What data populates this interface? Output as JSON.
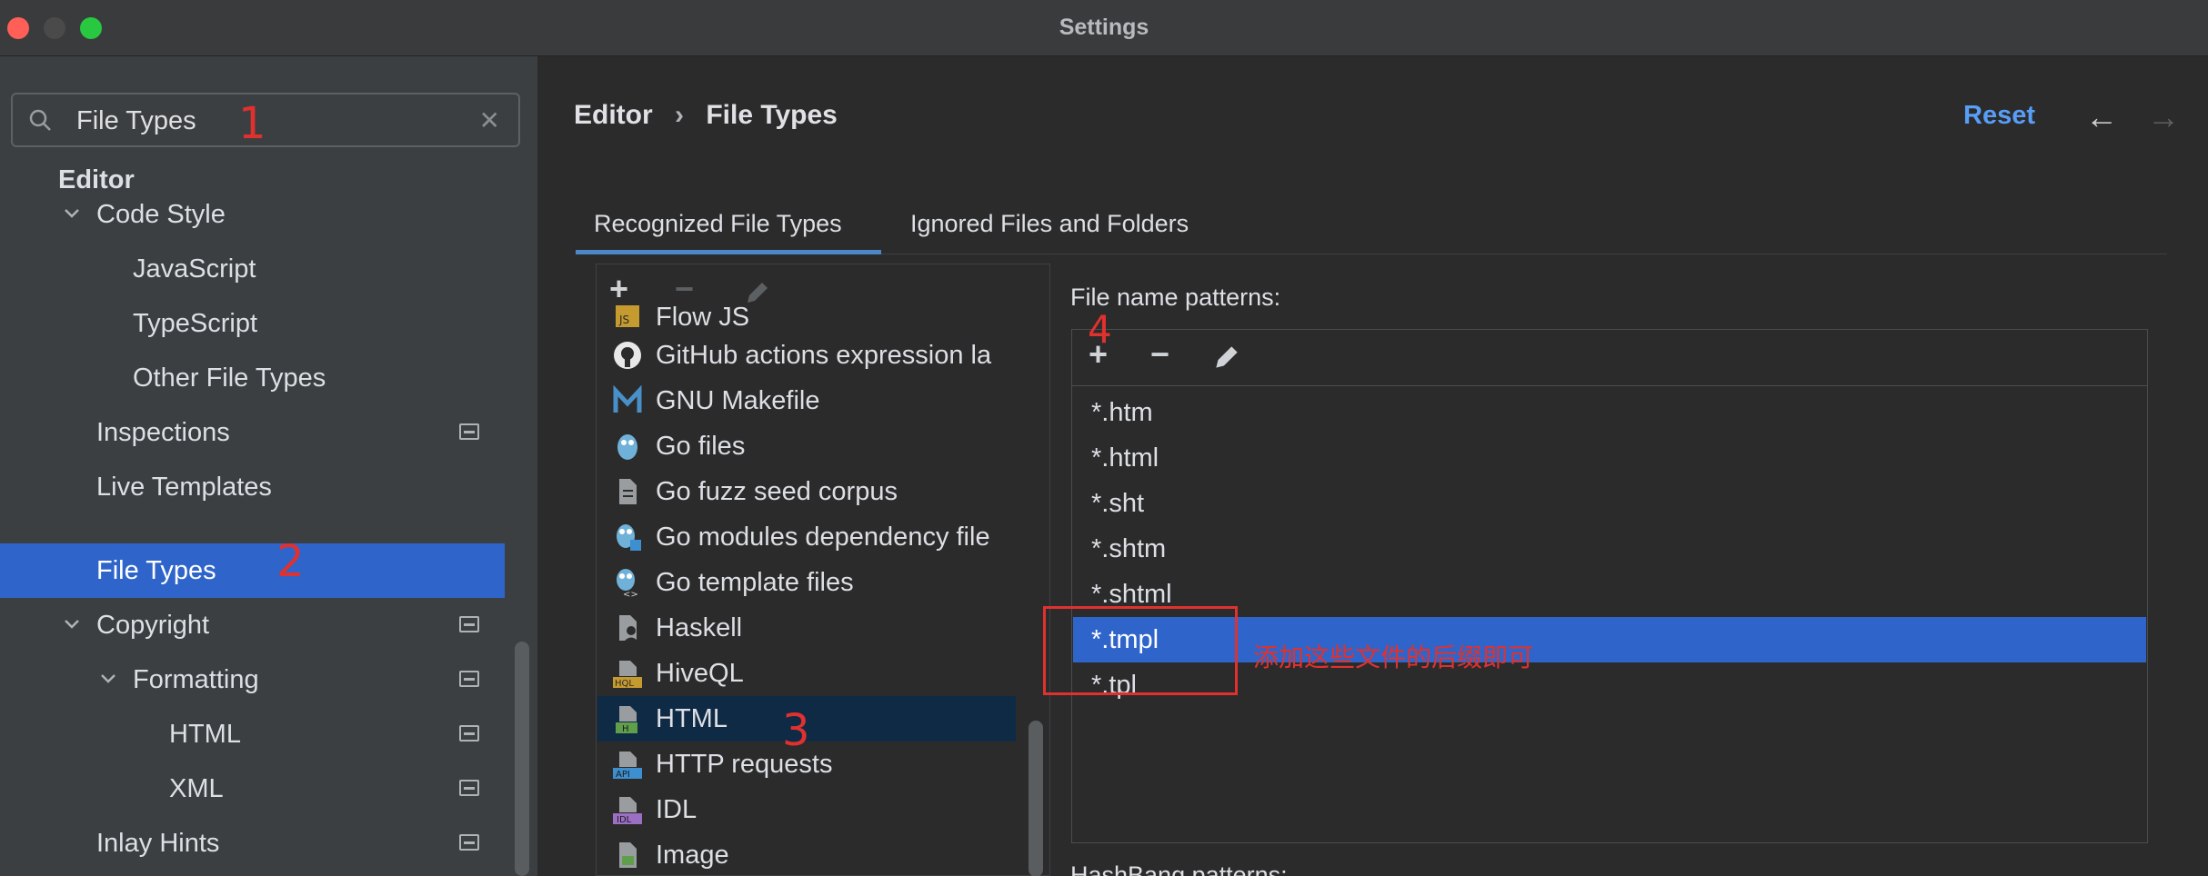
{
  "window": {
    "title": "Settings"
  },
  "search": {
    "value": "File Types"
  },
  "sidebar": {
    "items": [
      {
        "label": "Editor"
      },
      {
        "label": "Code Style"
      },
      {
        "label": "JavaScript"
      },
      {
        "label": "TypeScript"
      },
      {
        "label": "Other File Types"
      },
      {
        "label": "Inspections"
      },
      {
        "label": "Live Templates"
      },
      {
        "label": "File Types"
      },
      {
        "label": "Copyright"
      },
      {
        "label": "Formatting"
      },
      {
        "label": "HTML"
      },
      {
        "label": "XML"
      },
      {
        "label": "Inlay Hints"
      }
    ]
  },
  "breadcrumb": {
    "parent": "Editor",
    "separator": "›",
    "current": "File Types"
  },
  "header": {
    "reset_label": "Reset",
    "back_glyph": "←",
    "forward_glyph": "→"
  },
  "tabs": [
    {
      "label": "Recognized File Types",
      "active": true
    },
    {
      "label": "Ignored Files and Folders",
      "active": false
    }
  ],
  "toolbar": {
    "add": "+",
    "remove": "−"
  },
  "file_types": [
    {
      "label": "Flow JS",
      "icon": "flow-js-icon"
    },
    {
      "label": "GitHub actions expression la",
      "icon": "github-icon"
    },
    {
      "label": "GNU Makefile",
      "icon": "makefile-icon"
    },
    {
      "label": "Go files",
      "icon": "gopher-icon"
    },
    {
      "label": "Go fuzz seed corpus",
      "icon": "file-icon"
    },
    {
      "label": "Go modules dependency file",
      "icon": "gopher-module-icon"
    },
    {
      "label": "Go template files",
      "icon": "gopher-template-icon"
    },
    {
      "label": "Haskell",
      "icon": "haskell-icon"
    },
    {
      "label": "HiveQL",
      "icon": "hql-icon"
    },
    {
      "label": "HTML",
      "icon": "html-file-icon",
      "selected": true
    },
    {
      "label": "HTTP requests",
      "icon": "api-icon"
    },
    {
      "label": "IDL",
      "icon": "idl-icon"
    },
    {
      "label": "Image",
      "icon": "image-icon"
    }
  ],
  "patterns": {
    "label": "File name patterns:",
    "items": [
      {
        "value": "*.htm"
      },
      {
        "value": "*.html"
      },
      {
        "value": "*.sht"
      },
      {
        "value": "*.shtm"
      },
      {
        "value": "*.shtml"
      },
      {
        "value": "*.tmpl",
        "selected": true
      },
      {
        "value": "*.tpl"
      }
    ]
  },
  "hashbang": {
    "label": "HashBang patterns:"
  },
  "annotations": {
    "mark_1": "1",
    "mark_2": "2",
    "mark_3": "3",
    "mark_4": "4",
    "note": "添加这些文件的后缀即可"
  },
  "colors": {
    "accent": "#2f65ca",
    "link": "#589df6",
    "annotation": "#e0312f",
    "traffic_close": "#ff5f57",
    "traffic_min": "#4a4a4a",
    "traffic_max": "#28c840"
  }
}
